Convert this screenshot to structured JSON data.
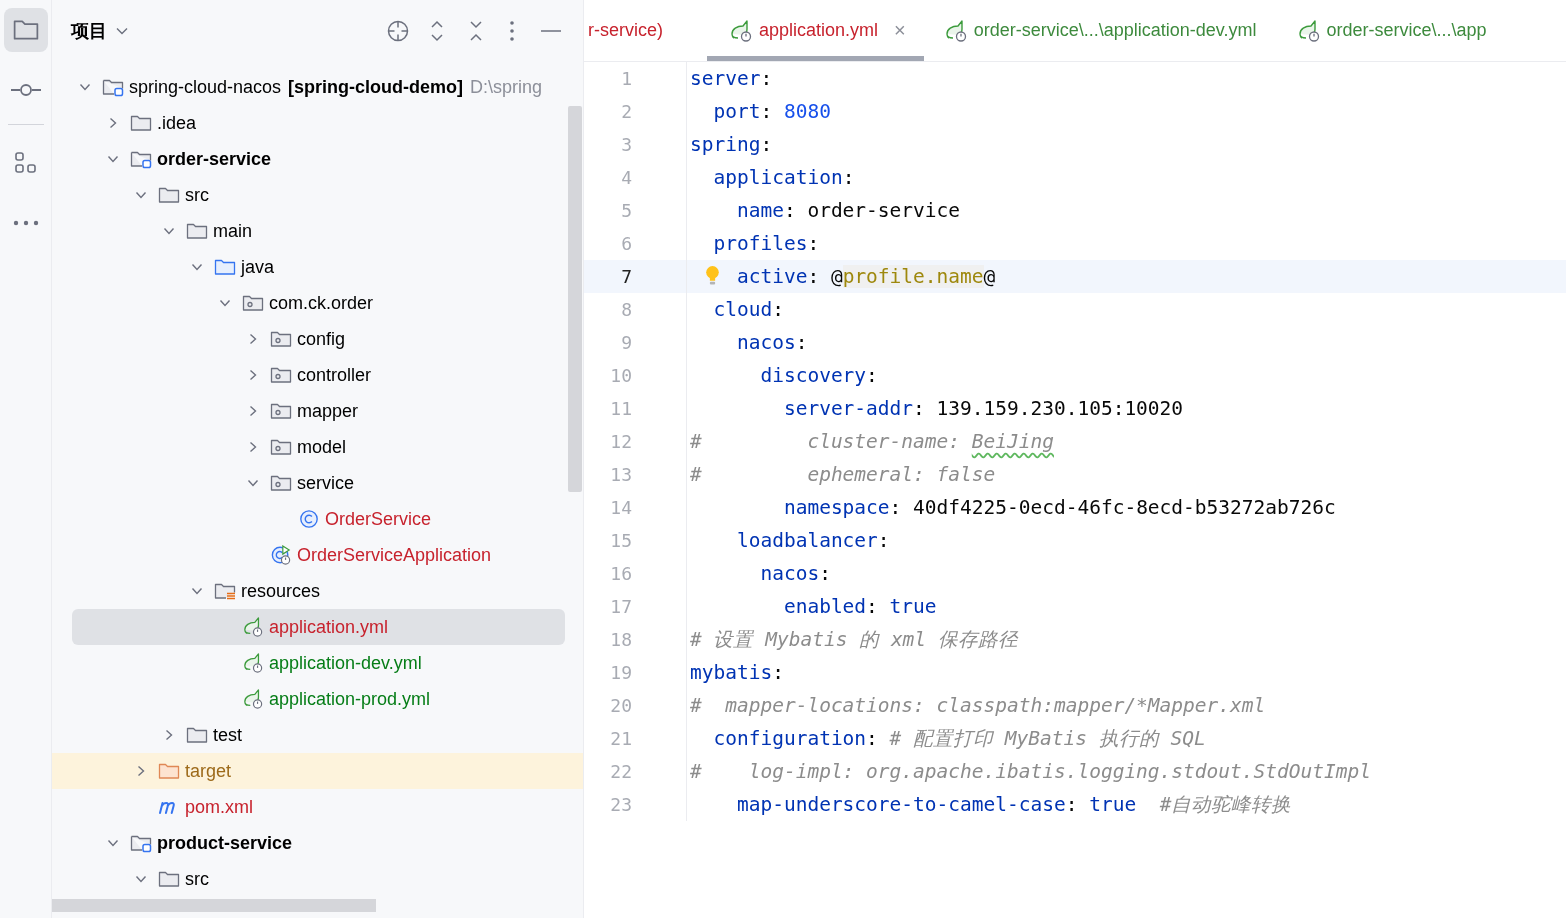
{
  "sidebar": {
    "tools": [
      {
        "kind": "project",
        "selected": true
      },
      {
        "kind": "commit",
        "selected": false
      },
      {
        "kind": "structure",
        "selected": false
      },
      {
        "kind": "more",
        "selected": false
      }
    ]
  },
  "project_panel": {
    "title": "项目",
    "tree": [
      {
        "label": "spring-cloud-nacos",
        "module_name": "[spring-cloud-demo]",
        "path": "D:\\spring",
        "kind": "project",
        "color": "#000000",
        "selected": false,
        "expanded": true,
        "children": [
          {
            "label": ".idea",
            "kind": "folder",
            "color": "#000000",
            "selected": false,
            "expanded": false
          },
          {
            "label": "order-service",
            "kind": "module",
            "color": "#000000",
            "selected": false,
            "expanded": true,
            "children": [
              {
                "label": "src",
                "kind": "folder",
                "color": "#000000",
                "selected": false,
                "expanded": true,
                "children": [
                  {
                    "label": "main",
                    "kind": "folder",
                    "color": "#000000",
                    "selected": false,
                    "expanded": true,
                    "children": [
                      {
                        "label": "java",
                        "kind": "source-folder",
                        "color": "#000000",
                        "selected": false,
                        "expanded": true,
                        "children": [
                          {
                            "label": "com.ck.order",
                            "kind": "package",
                            "color": "#000000",
                            "selected": false,
                            "expanded": true,
                            "children": [
                              {
                                "label": "config",
                                "kind": "package",
                                "color": "#000000",
                                "selected": false,
                                "expanded": false
                              },
                              {
                                "label": "controller",
                                "kind": "package",
                                "color": "#000000",
                                "selected": false,
                                "expanded": false
                              },
                              {
                                "label": "mapper",
                                "kind": "package",
                                "color": "#000000",
                                "selected": false,
                                "expanded": false
                              },
                              {
                                "label": "model",
                                "kind": "package",
                                "color": "#000000",
                                "selected": false,
                                "expanded": false
                              },
                              {
                                "label": "service",
                                "kind": "package",
                                "color": "#000000",
                                "selected": false,
                                "expanded": true,
                                "children": [
                                  {
                                    "label": "OrderService",
                                    "kind": "class",
                                    "color": "#c7222d",
                                    "selected": false
                                  }
                                ]
                              },
                              {
                                "label": "OrderServiceApplication",
                                "kind": "app-class",
                                "color": "#c7222d",
                                "selected": false
                              }
                            ]
                          }
                        ]
                      },
                      {
                        "label": "resources",
                        "kind": "resources-folder",
                        "color": "#000000",
                        "selected": false,
                        "expanded": true,
                        "children": [
                          {
                            "label": "application.yml",
                            "kind": "spring-config",
                            "color": "#c7222d",
                            "selected": true
                          },
                          {
                            "label": "application-dev.yml",
                            "kind": "spring-config",
                            "color": "#067d17",
                            "selected": false
                          },
                          {
                            "label": "application-prod.yml",
                            "kind": "spring-config",
                            "color": "#067d17",
                            "selected": false
                          }
                        ]
                      }
                    ]
                  },
                  {
                    "label": "test",
                    "kind": "folder",
                    "color": "#000000",
                    "selected": false,
                    "expanded": false
                  }
                ]
              },
              {
                "label": "target",
                "kind": "excluded-folder",
                "color": "#9d6a1a",
                "selected": false,
                "expanded": false
              },
              {
                "label": "pom.xml",
                "kind": "maven",
                "color": "#c7222d",
                "selected": false
              }
            ]
          },
          {
            "label": "product-service",
            "kind": "module",
            "color": "#000000",
            "selected": false,
            "expanded": true,
            "children": [
              {
                "label": "src",
                "kind": "folder",
                "color": "#000000",
                "selected": false,
                "expanded": true
              }
            ]
          }
        ]
      }
    ]
  },
  "editor": {
    "tabs": [
      {
        "label": "r-service)",
        "kind": "partial",
        "color": "#c7222d",
        "selected": false
      },
      {
        "label": "application.yml",
        "kind": "spring-config",
        "color": "#c7222d",
        "selected": true,
        "close": "×"
      },
      {
        "label": "order-service\\...\\application-dev.yml",
        "kind": "spring-config",
        "color": "#3d8a3d",
        "selected": false
      },
      {
        "label": "order-service\\...\\app",
        "kind": "spring-config",
        "color": "#3d8a3d",
        "selected": false
      }
    ],
    "lines": [
      {
        "n": "1",
        "current": false,
        "bulb": false,
        "segs": [
          {
            "t": "server",
            "kind": "key"
          },
          {
            "t": ":",
            "kind": "plain"
          }
        ]
      },
      {
        "n": "2",
        "current": false,
        "bulb": false,
        "segs": [
          {
            "t": "  port",
            "kind": "key"
          },
          {
            "t": ": ",
            "kind": "plain"
          },
          {
            "t": "8080",
            "kind": "number"
          }
        ]
      },
      {
        "n": "3",
        "current": false,
        "bulb": false,
        "segs": [
          {
            "t": "spring",
            "kind": "key"
          },
          {
            "t": ":",
            "kind": "plain"
          }
        ]
      },
      {
        "n": "4",
        "current": false,
        "bulb": false,
        "segs": [
          {
            "t": "  application",
            "kind": "key"
          },
          {
            "t": ":",
            "kind": "plain"
          }
        ]
      },
      {
        "n": "5",
        "current": false,
        "bulb": false,
        "segs": [
          {
            "t": "    name",
            "kind": "key"
          },
          {
            "t": ": order-service",
            "kind": "plain"
          }
        ]
      },
      {
        "n": "6",
        "current": false,
        "bulb": false,
        "segs": [
          {
            "t": "  profiles",
            "kind": "key"
          },
          {
            "t": ":",
            "kind": "plain"
          }
        ]
      },
      {
        "n": "7",
        "current": true,
        "bulb": true,
        "segs": [
          {
            "t": "    active",
            "kind": "key"
          },
          {
            "t": ": @",
            "kind": "plain"
          },
          {
            "t": "profile.name",
            "kind": "template"
          },
          {
            "t": "@",
            "kind": "plain"
          }
        ]
      },
      {
        "n": "8",
        "current": false,
        "bulb": false,
        "segs": [
          {
            "t": "  cloud",
            "kind": "key"
          },
          {
            "t": ":",
            "kind": "plain"
          }
        ]
      },
      {
        "n": "9",
        "current": false,
        "bulb": false,
        "segs": [
          {
            "t": "    nacos",
            "kind": "key"
          },
          {
            "t": ":",
            "kind": "plain"
          }
        ]
      },
      {
        "n": "10",
        "current": false,
        "bulb": false,
        "segs": [
          {
            "t": "      discovery",
            "kind": "key"
          },
          {
            "t": ":",
            "kind": "plain"
          }
        ]
      },
      {
        "n": "11",
        "current": false,
        "bulb": false,
        "segs": [
          {
            "t": "        server-addr",
            "kind": "key"
          },
          {
            "t": ": 139.159.230.105:10020",
            "kind": "plain"
          }
        ]
      },
      {
        "n": "12",
        "current": false,
        "bulb": false,
        "segs": [
          {
            "t": "#         cluster-name: ",
            "kind": "comment"
          },
          {
            "t": "BeiJing",
            "kind": "typo-comment"
          }
        ]
      },
      {
        "n": "13",
        "current": false,
        "bulb": false,
        "segs": [
          {
            "t": "#         ephemeral: false",
            "kind": "comment"
          }
        ]
      },
      {
        "n": "14",
        "current": false,
        "bulb": false,
        "segs": [
          {
            "t": "        namespace",
            "kind": "key"
          },
          {
            "t": ": 40df4225-0ecd-46fc-8ecd-b53272ab726c",
            "kind": "plain"
          }
        ]
      },
      {
        "n": "15",
        "current": false,
        "bulb": false,
        "segs": [
          {
            "t": "    loadbalancer",
            "kind": "key"
          },
          {
            "t": ":",
            "kind": "plain"
          }
        ]
      },
      {
        "n": "16",
        "current": false,
        "bulb": false,
        "segs": [
          {
            "t": "      nacos",
            "kind": "key"
          },
          {
            "t": ":",
            "kind": "plain"
          }
        ]
      },
      {
        "n": "17",
        "current": false,
        "bulb": false,
        "segs": [
          {
            "t": "        enabled",
            "kind": "key"
          },
          {
            "t": ": ",
            "kind": "plain"
          },
          {
            "t": "true",
            "kind": "key"
          }
        ]
      },
      {
        "n": "18",
        "current": false,
        "bulb": false,
        "segs": [
          {
            "t": "# 设置 Mybatis 的 xml 保存路径",
            "kind": "comment"
          }
        ]
      },
      {
        "n": "19",
        "current": false,
        "bulb": false,
        "segs": [
          {
            "t": "mybatis",
            "kind": "key"
          },
          {
            "t": ":",
            "kind": "plain"
          }
        ]
      },
      {
        "n": "20",
        "current": false,
        "bulb": false,
        "segs": [
          {
            "t": "#  mapper-locations: classpath:mapper/*Mapper.xml",
            "kind": "comment"
          }
        ]
      },
      {
        "n": "21",
        "current": false,
        "bulb": false,
        "segs": [
          {
            "t": "  configuration",
            "kind": "key"
          },
          {
            "t": ": ",
            "kind": "plain"
          },
          {
            "t": "# 配置打印 MyBatis 执行的 SQL",
            "kind": "comment"
          }
        ]
      },
      {
        "n": "22",
        "current": false,
        "bulb": false,
        "segs": [
          {
            "t": "#    log-impl: org.apache.ibatis.logging.stdout.StdOutImpl",
            "kind": "comment"
          }
        ]
      },
      {
        "n": "23",
        "current": false,
        "bulb": false,
        "segs": [
          {
            "t": "    map-underscore-to-camel-case",
            "kind": "key"
          },
          {
            "t": ": ",
            "kind": "plain"
          },
          {
            "t": "true  ",
            "kind": "key"
          },
          {
            "t": "#自动驼峰转换",
            "kind": "comment"
          }
        ]
      }
    ]
  }
}
